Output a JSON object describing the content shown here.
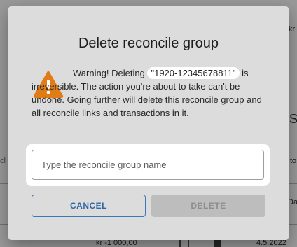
{
  "background": {
    "fragments": {
      "top_right": "kr",
      "mid_right_s": "S",
      "mid_left": "cl",
      "mid_right_to": "to",
      "right_date_head": "Da",
      "bottom_amount": "kr -1 000,00",
      "bottom_date": "4.5.2022"
    }
  },
  "dialog": {
    "title": "Delete reconcile group",
    "icon": "warning-icon",
    "warning_prefix": "Warning! Deleting",
    "group_name": "\"1920-12345678811\"",
    "warning_suffix": "is irreversible. The action you're about to take can't be undone. Going further will delete this reconcile group and all reconcile links and transactions in it.",
    "input": {
      "value": "",
      "placeholder": "Type the reconcile group name"
    },
    "cancel_label": "CANCEL",
    "delete_label": "DELETE"
  },
  "colors": {
    "warning": "#e07b16",
    "cancel_text": "#2c66a6",
    "dialog_bg": "#dcdcdc",
    "delete_disabled_bg": "#bdbdbd"
  }
}
